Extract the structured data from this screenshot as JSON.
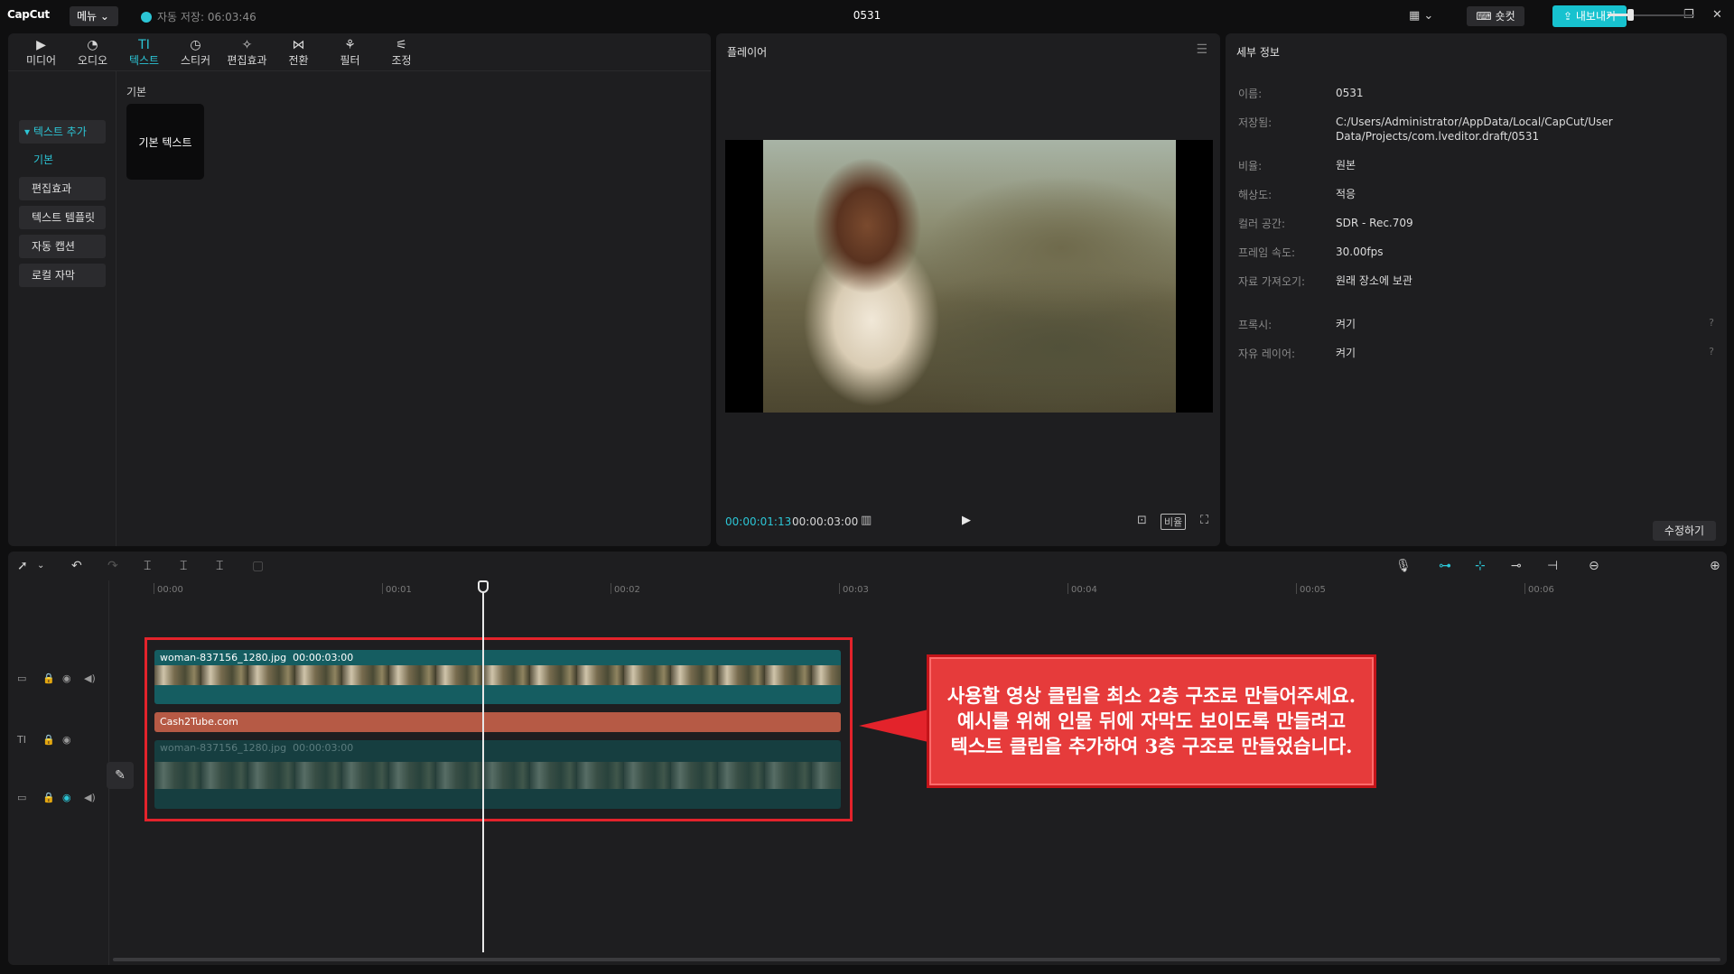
{
  "app": {
    "logo": "CapCut",
    "menu_label": "메뉴",
    "autosave": "자동 저장: 06:03:46",
    "title": "0531",
    "shortcut_label": "숏컷",
    "export_label": "내보내기"
  },
  "media_toolbar": [
    {
      "label": "미디어",
      "icon": "media-icon"
    },
    {
      "label": "오디오",
      "icon": "audio-icon"
    },
    {
      "label": "텍스트",
      "icon": "text-icon",
      "active": true
    },
    {
      "label": "스티커",
      "icon": "sticker-icon"
    },
    {
      "label": "편집효과",
      "icon": "effects-icon"
    },
    {
      "label": "전환",
      "icon": "transition-icon"
    },
    {
      "label": "필터",
      "icon": "filter-icon"
    },
    {
      "label": "조정",
      "icon": "adjust-icon"
    }
  ],
  "text_nav": {
    "add_text": "▾ 텍스트 추가",
    "basic": "기본",
    "effects": "편집효과",
    "templates": "텍스트 템플릿",
    "auto_caption": "자동 캡션",
    "local_caption": "로컬 자막"
  },
  "text_content": {
    "section_title": "기본",
    "card_label": "기본 텍스트"
  },
  "player": {
    "title": "플레이어",
    "current_time": "00:00:01:13",
    "total_time": "00:00:03:00",
    "ratio_label": "비율"
  },
  "details": {
    "title": "세부 정보",
    "rows": [
      {
        "label": "이름:",
        "value": "0531"
      },
      {
        "label": "저장됨:",
        "value": "C:/Users/Administrator/AppData/Local/CapCut/User Data/Projects/com.lveditor.draft/0531"
      },
      {
        "label": "비율:",
        "value": "원본"
      },
      {
        "label": "해상도:",
        "value": "적응"
      },
      {
        "label": "컬러 공간:",
        "value": "SDR - Rec.709"
      },
      {
        "label": "프레임 속도:",
        "value": "30.00fps"
      },
      {
        "label": "자료 가져오기:",
        "value": "원래 장소에 보관"
      },
      {
        "label": "프록시:",
        "value": "켜기"
      },
      {
        "label": "자유 레이어:",
        "value": "켜기"
      }
    ],
    "edit_label": "수정하기"
  },
  "timeline": {
    "ruler": [
      "00:00",
      "00:01",
      "00:02",
      "00:03",
      "00:04",
      "00:05",
      "00:06"
    ],
    "main_clip": {
      "name": "woman-837156_1280.jpg",
      "duration": "00:00:03:00"
    },
    "text_clip": {
      "name": "Cash2Tube.com"
    },
    "bg_clip": {
      "name": "woman-837156_1280.jpg",
      "duration": "00:00:03:00"
    }
  },
  "annotation": {
    "lines": [
      "사용할 영상 클립을 최소 2층 구조로 만들어주세요.",
      "예시를 위해 인물 뒤에 자막도 보이도록 만들려고",
      "텍스트 클립을 추가하여 3층 구조로 만들었습니다."
    ]
  },
  "colors": {
    "accent": "#2cc6d6",
    "annotation_red": "#e3232b",
    "text_clip": "#b65a45",
    "video_clip": "#155d61"
  }
}
